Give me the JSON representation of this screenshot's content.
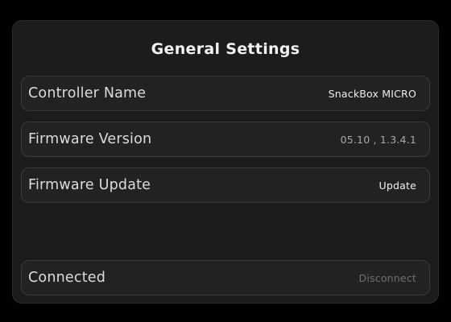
{
  "panel": {
    "title": "General Settings"
  },
  "rows": {
    "controller_name": {
      "label": "Controller Name",
      "value": "SnackBox MICRO"
    },
    "firmware_version": {
      "label": "Firmware Version",
      "value": "05.10 , 1.3.4.1"
    },
    "firmware_update": {
      "label": "Firmware Update",
      "action": "Update"
    },
    "connection": {
      "label": "Connected",
      "action": "Disconnect"
    }
  },
  "colors": {
    "background": "#000000",
    "panel": "#1c1c1c",
    "row": "#222222",
    "row_border": "#3a3a3a",
    "text_primary": "#f2f2f2",
    "text_muted": "#a9a9a9",
    "text_disabled": "#6f6f6f"
  }
}
